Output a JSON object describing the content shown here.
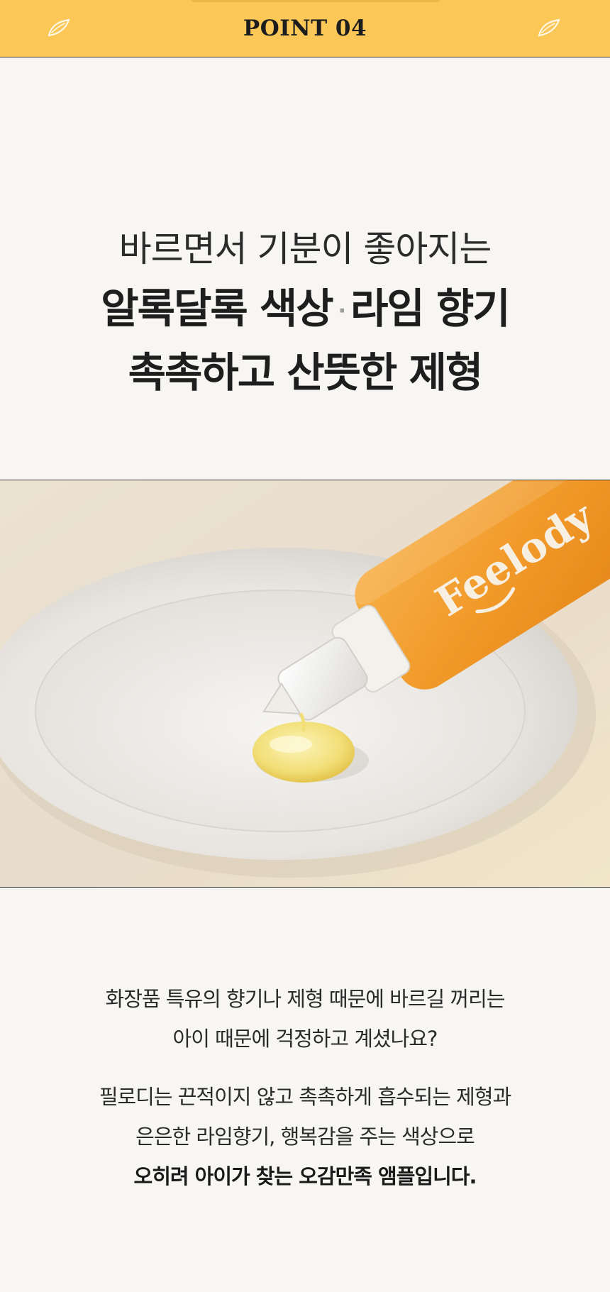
{
  "header": {
    "title": "POINT 04",
    "accent_color": "#fbc757",
    "left_icon": "leaf-icon",
    "right_icon": "leaf-icon"
  },
  "hero": {
    "line1": "바르면서 기분이 좋아지는",
    "line2_part1": "알록달록 색상",
    "line2_separator": "·",
    "line2_part2": "라임 향기",
    "line3": "촉촉하고 산뜻한 제형"
  },
  "product_photo": {
    "brand_text": "Feelody",
    "bottle_color": "#f19a2a"
  },
  "description": {
    "paragraph1": [
      "화장품 특유의 향기나 제형 때문에 바르길 꺼리는",
      "아이 때문에 걱정하고 계셨나요?"
    ],
    "paragraph2": [
      "필로디는 끈적이지 않고 촉촉하게 흡수되는 제형과",
      "은은한 라임향기, 행복감을 주는 색상으로"
    ],
    "paragraph2_bold": "오히려 아이가 찾는 오감만족 앰플입니다."
  }
}
